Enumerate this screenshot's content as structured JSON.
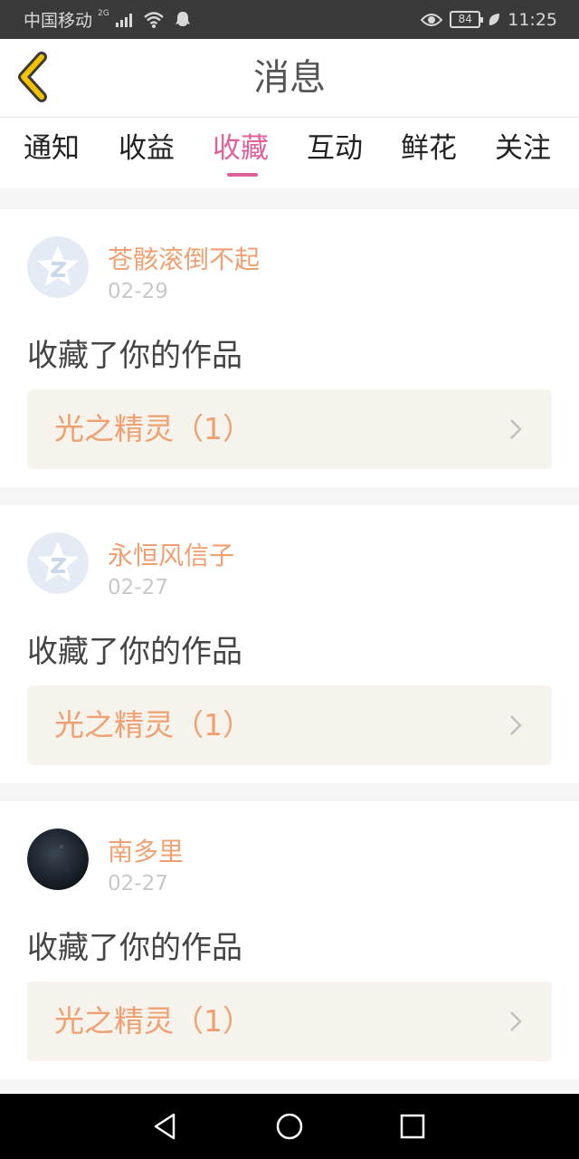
{
  "status_bar": {
    "carrier": "中国移动",
    "network": "2G",
    "battery": "84",
    "time": "11:25"
  },
  "header": {
    "title": "消息",
    "back_icon": "chevron-left-icon"
  },
  "tabs": [
    {
      "label": "通知"
    },
    {
      "label": "收益"
    },
    {
      "label": "收藏",
      "active": true
    },
    {
      "label": "互动"
    },
    {
      "label": "鲜花"
    },
    {
      "label": "关注"
    }
  ],
  "messages": [
    {
      "username": "苍骸滚倒不起",
      "date": "02-29",
      "action": "收藏了你的作品",
      "work": "光之精灵（1）",
      "avatar": "qzone-star-avatar"
    },
    {
      "username": "永恒风信子",
      "date": "02-27",
      "action": "收藏了你的作品",
      "work": "光之精灵（1）",
      "avatar": "qzone-star-avatar"
    },
    {
      "username": "南多里",
      "date": "02-27",
      "action": "收藏了你的作品",
      "work": "光之精灵（1）",
      "avatar": "dark-photo-avatar"
    }
  ],
  "colors": {
    "accent": "#e0609a",
    "orange": "#f0a070",
    "card_highlight": "#f5f3ec",
    "back_chevron": "#f2c200"
  }
}
